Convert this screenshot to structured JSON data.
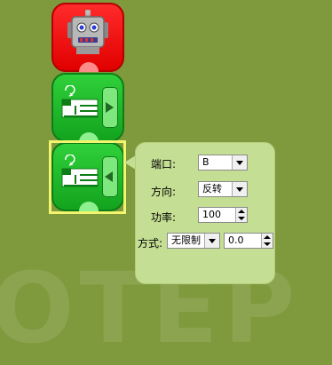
{
  "watermark": {
    "text": "OTEP"
  },
  "blocks": [
    {
      "type": "robot-start",
      "icon": "robot-icon",
      "color": "#ff1a1a"
    },
    {
      "type": "motor",
      "icon": "motor-icon",
      "color": "#22c02c",
      "tab": "expand-right"
    },
    {
      "type": "motor",
      "icon": "motor-icon",
      "color": "#22c02c",
      "tab": "collapse-left",
      "selected": true
    }
  ],
  "settings": {
    "port": {
      "label": "端口:",
      "value": "B"
    },
    "direction": {
      "label": "方向:",
      "value": "反转"
    },
    "power": {
      "label": "功率:",
      "value": "100"
    },
    "mode": {
      "label": "方式:",
      "value": "无限制",
      "amount": "0.0"
    }
  },
  "colors": {
    "background": "#7f9a3d",
    "popup": "#c4de93",
    "selection": "#f2f56d"
  }
}
